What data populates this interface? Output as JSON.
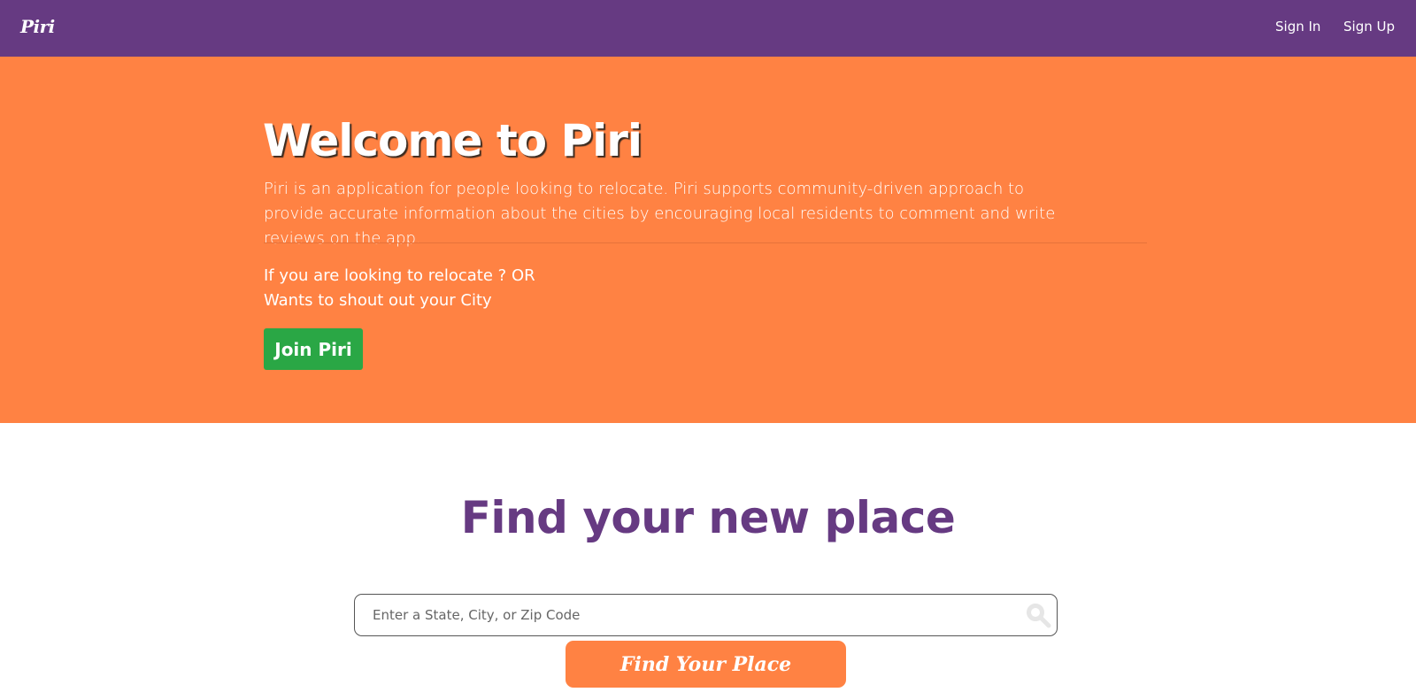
{
  "navbar": {
    "brand": "Piri",
    "links": [
      "Sign In",
      "Sign Up"
    ]
  },
  "hero": {
    "title": "Welcome to Piri",
    "description": "Piri is an application for people looking to relocate. Piri supports community-driven approach to provide accurate information about the cities by encouraging local residents to comment and write reviews on the app.",
    "line1": "If you are looking to relocate ? OR",
    "line2": "Wants to shout out your City",
    "join_label": "Join Piri"
  },
  "search": {
    "title": "Find your new place",
    "placeholder": "Enter a State, City, or Zip Code",
    "value": "",
    "icon": "search-icon",
    "button_label": "Find Your Place"
  },
  "colors": {
    "navbar": "#663a82",
    "hero": "#ff8243",
    "join_button": "#2aa745",
    "title": "#663a82",
    "find_button": "#ff8243"
  }
}
